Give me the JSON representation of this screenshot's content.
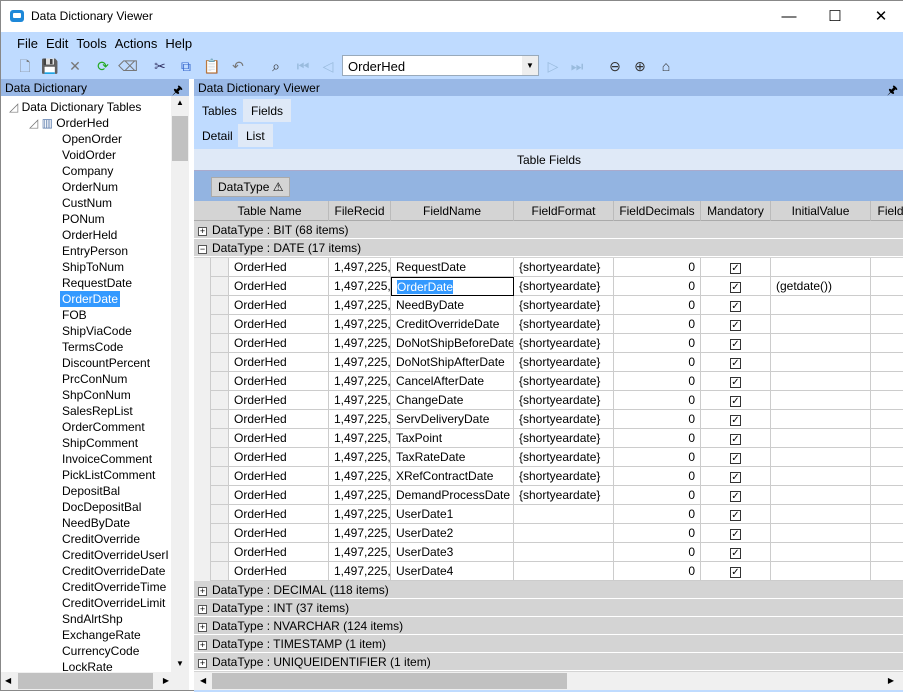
{
  "window": {
    "title": "Data Dictionary Viewer",
    "min": "—",
    "max": "☐",
    "close": "✕"
  },
  "menu": [
    "File",
    "Edit",
    "Tools",
    "Actions",
    "Help"
  ],
  "toolbar": {
    "combo_value": "OrderHed"
  },
  "left_panel": {
    "title": "Data Dictionary",
    "root": "Data Dictionary Tables",
    "table": "OrderHed",
    "selected": "OrderDate",
    "fields": [
      "OpenOrder",
      "VoidOrder",
      "Company",
      "OrderNum",
      "CustNum",
      "PONum",
      "OrderHeld",
      "EntryPerson",
      "ShipToNum",
      "RequestDate",
      "OrderDate",
      "FOB",
      "ShipViaCode",
      "TermsCode",
      "DiscountPercent",
      "PrcConNum",
      "ShpConNum",
      "SalesRepList",
      "OrderComment",
      "ShipComment",
      "InvoiceComment",
      "PickListComment",
      "DepositBal",
      "DocDepositBal",
      "NeedByDate",
      "CreditOverride",
      "CreditOverrideUserI",
      "CreditOverrideDate",
      "CreditOverrideTime",
      "CreditOverrideLimit",
      "SndAlrtShp",
      "ExchangeRate",
      "CurrencyCode",
      "LockRate"
    ]
  },
  "right_panel": {
    "title": "Data Dictionary Viewer",
    "tabs": [
      "Tables",
      "Fields"
    ],
    "active_tab": "Fields",
    "subtabs": [
      "Detail",
      "List"
    ],
    "active_subtab": "List",
    "grid_title": "Table Fields",
    "group_by": "DataType ⚠",
    "columns": [
      "Table Name",
      "FileRecid",
      "FieldName",
      "FieldFormat",
      "FieldDecimals",
      "Mandatory",
      "InitialValue",
      "Field"
    ],
    "groups_before": [
      {
        "label": "DataType : BIT (68 items)",
        "expanded": false
      },
      {
        "label": "DataType : DATE (17 items)",
        "expanded": true
      }
    ],
    "rows": [
      [
        "OrderHed",
        "1,497,225,",
        "RequestDate",
        "{shortyeardate}",
        "0",
        true,
        ""
      ],
      [
        "OrderHed",
        "1,497,225,",
        "OrderDate",
        "{shortyeardate}",
        "0",
        true,
        "(getdate())"
      ],
      [
        "OrderHed",
        "1,497,225,",
        "NeedByDate",
        "{shortyeardate}",
        "0",
        true,
        ""
      ],
      [
        "OrderHed",
        "1,497,225,",
        "CreditOverrideDate",
        "{shortyeardate}",
        "0",
        true,
        ""
      ],
      [
        "OrderHed",
        "1,497,225,",
        "DoNotShipBeforeDate",
        "{shortyeardate}",
        "0",
        true,
        ""
      ],
      [
        "OrderHed",
        "1,497,225,",
        "DoNotShipAfterDate",
        "{shortyeardate}",
        "0",
        true,
        ""
      ],
      [
        "OrderHed",
        "1,497,225,",
        "CancelAfterDate",
        "{shortyeardate}",
        "0",
        true,
        ""
      ],
      [
        "OrderHed",
        "1,497,225,",
        "ChangeDate",
        "{shortyeardate}",
        "0",
        true,
        ""
      ],
      [
        "OrderHed",
        "1,497,225,",
        "ServDeliveryDate",
        "{shortyeardate}",
        "0",
        true,
        ""
      ],
      [
        "OrderHed",
        "1,497,225,",
        "TaxPoint",
        "{shortyeardate}",
        "0",
        true,
        ""
      ],
      [
        "OrderHed",
        "1,497,225,",
        "TaxRateDate",
        "{shortyeardate}",
        "0",
        true,
        ""
      ],
      [
        "OrderHed",
        "1,497,225,",
        "XRefContractDate",
        "{shortyeardate}",
        "0",
        true,
        ""
      ],
      [
        "OrderHed",
        "1,497,225,",
        "DemandProcessDate",
        "{shortyeardate}",
        "0",
        true,
        ""
      ],
      [
        "OrderHed",
        "1,497,225,",
        "UserDate1",
        "",
        "0",
        true,
        ""
      ],
      [
        "OrderHed",
        "1,497,225,",
        "UserDate2",
        "",
        "0",
        true,
        ""
      ],
      [
        "OrderHed",
        "1,497,225,",
        "UserDate3",
        "",
        "0",
        true,
        ""
      ],
      [
        "OrderHed",
        "1,497,225,",
        "UserDate4",
        "",
        "0",
        true,
        ""
      ]
    ],
    "selected_row": 1,
    "groups_after": [
      "DataType : DECIMAL (118 items)",
      "DataType : INT (37 items)",
      "DataType : NVARCHAR (124 items)",
      "DataType : TIMESTAMP (1 item)",
      "DataType : UNIQUEIDENTIFIER (1 item)"
    ]
  }
}
